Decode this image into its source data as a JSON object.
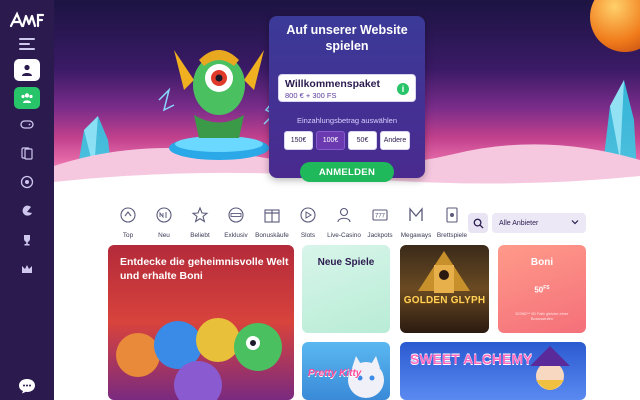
{
  "hero": {
    "card_title": "Auf unserer Website spielen",
    "bonus_title": "Willkommenspaket",
    "bonus_sub": "800 € + 300 FS",
    "info_glyph": "i",
    "deposit_label": "Einzahlungsbetrag auswählen",
    "amounts": [
      "150€",
      "100€",
      "50€",
      "Andere"
    ],
    "selected_amount": "100€",
    "cta_label": "ANMELDEN"
  },
  "categories": [
    {
      "label": "Top",
      "icon": "top-icon"
    },
    {
      "label": "Neu",
      "icon": "new-icon"
    },
    {
      "label": "Beliebt",
      "icon": "star-icon"
    },
    {
      "label": "Exklusiv",
      "icon": "exclusive-icon"
    },
    {
      "label": "Bonuskäufe",
      "icon": "bonus-buy-icon"
    },
    {
      "label": "Slots",
      "icon": "slots-icon"
    },
    {
      "label": "Live-Casino",
      "icon": "live-casino-icon"
    },
    {
      "label": "Jackpots",
      "icon": "jackpot-icon"
    },
    {
      "label": "Megaways",
      "icon": "megaways-icon"
    },
    {
      "label": "Brettspiele",
      "icon": "board-games-icon"
    }
  ],
  "filters": {
    "provider_label": "Alle Anbieter"
  },
  "tiles": {
    "big_title": "Entdecke die geheimnisvolle Welt und erhalte Boni",
    "new_games": "Neue Spiele",
    "golden_glyph": "GOLDEN GLYPH",
    "boni_title": "Boni",
    "boni_value": "50",
    "boni_value_unit": "FS",
    "boni_note": "DONE** 50 Fakt gleiche einer Bonusstufen",
    "kitty": "Pretty Kitty",
    "sweet": "SWEET ALCHEMY"
  },
  "colors": {
    "sidebar": "#2a1a4e",
    "accent_green": "#1fb85a",
    "card_purple": "#3b3a98"
  }
}
